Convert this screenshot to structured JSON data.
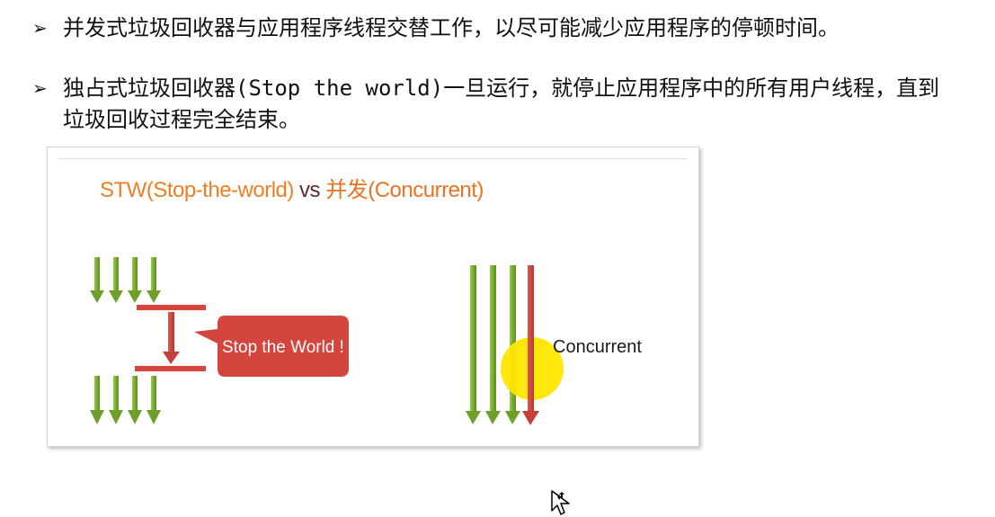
{
  "bullets": [
    {
      "marker": "➢",
      "text": "并发式垃圾回收器与应用程序线程交替工作，以尽可能减少应用程序的停顿时间。"
    },
    {
      "marker": "➢",
      "text_before": "独占式垃圾回收器",
      "text_mono": "(Stop the world)",
      "text_after": "一旦运行，就停止应用程序中的所有用户线程，直到垃圾回收过程完全结束。"
    }
  ],
  "diagram": {
    "title": {
      "stw": "STW(Stop-the-world)",
      "vs": " vs ",
      "concurrent": "并发(Concurrent)"
    },
    "stop_bubble": "Stop the World !",
    "concurrent_label": "Concurrent"
  },
  "colors": {
    "green": "#7fb237",
    "red": "#d4453d",
    "orange": "#ef7f22",
    "bubble": "#d4453d",
    "highlight": "#ffe500"
  }
}
